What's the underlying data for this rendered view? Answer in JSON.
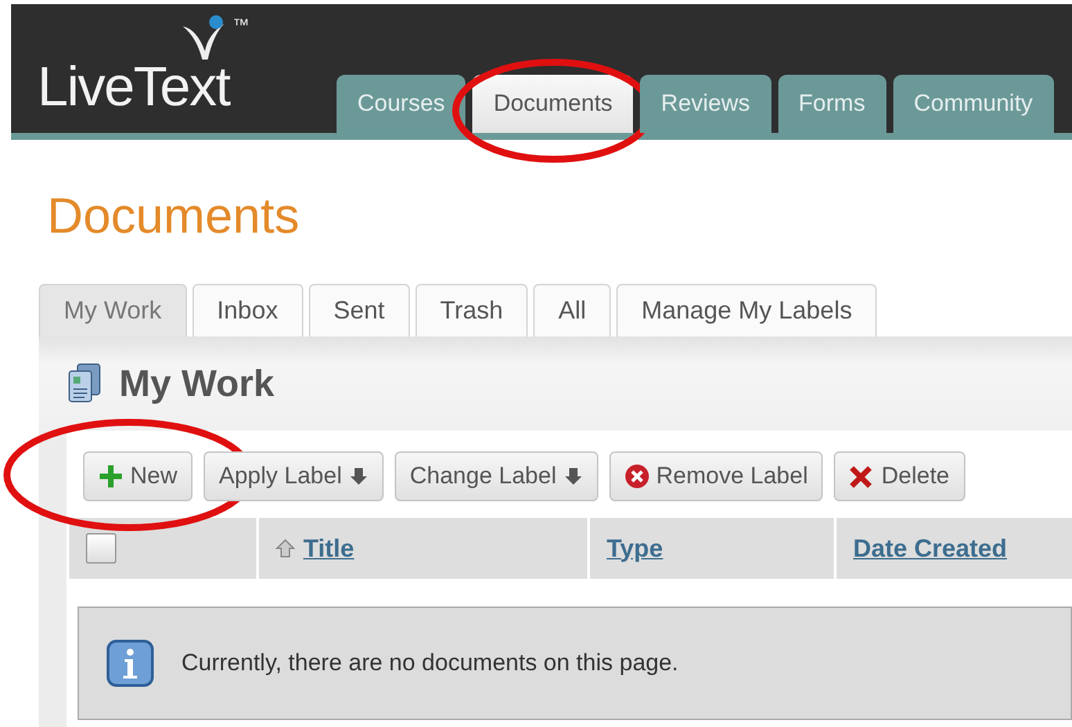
{
  "logo": {
    "text": "LiveText",
    "trademark": "™"
  },
  "main_tabs": [
    {
      "label": "Courses",
      "selected": false,
      "circled": false
    },
    {
      "label": "Documents",
      "selected": true,
      "circled": true
    },
    {
      "label": "Reviews",
      "selected": false,
      "circled": false
    },
    {
      "label": "Forms",
      "selected": false,
      "circled": false
    },
    {
      "label": "Community",
      "selected": false,
      "circled": false
    }
  ],
  "page_title": "Documents",
  "sub_tabs": [
    {
      "label": "My Work",
      "selected": true
    },
    {
      "label": "Inbox",
      "selected": false
    },
    {
      "label": "Sent",
      "selected": false
    },
    {
      "label": "Trash",
      "selected": false
    },
    {
      "label": "All",
      "selected": false
    },
    {
      "label": "Manage My Labels",
      "selected": false
    }
  ],
  "panel_title": "My Work",
  "toolbar": [
    {
      "label": "New",
      "kind": "new",
      "circled": true
    },
    {
      "label": "Apply Label",
      "kind": "dropdown",
      "circled": false
    },
    {
      "label": "Change Label",
      "kind": "dropdown",
      "circled": false
    },
    {
      "label": "Remove Label",
      "kind": "remove",
      "circled": false
    },
    {
      "label": "Delete",
      "kind": "delete",
      "circled": false
    }
  ],
  "table": {
    "select_all_checked": false,
    "columns": [
      {
        "label": "Title",
        "sorted": true
      },
      {
        "label": "Type",
        "sorted": false
      },
      {
        "label": "Date Created",
        "sorted": false
      }
    ]
  },
  "message": "Currently, there are no documents on this page."
}
